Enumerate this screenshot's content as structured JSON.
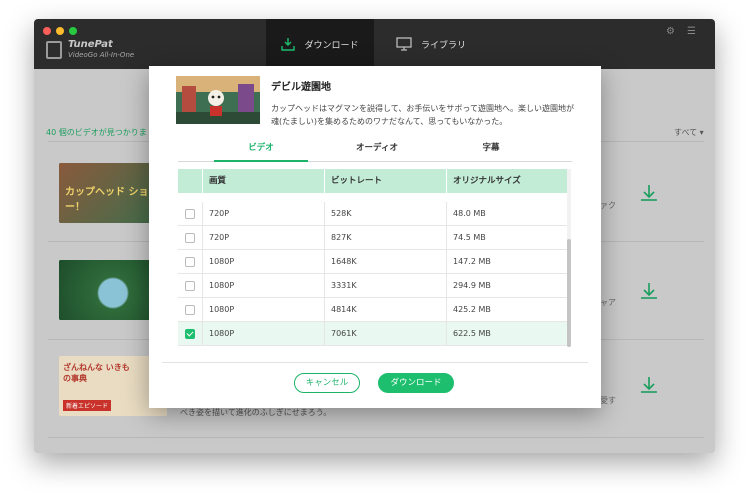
{
  "app": {
    "name": "TunePat",
    "subtitle": "VideoGo All-In-One",
    "tabs": [
      {
        "label": "ダウンロード",
        "active": true
      },
      {
        "label": "ライブラリ",
        "active": false
      }
    ],
    "accent": "#1dbf6e"
  },
  "background": {
    "found_text": "40 個のビデオが見つかりま",
    "filter": "すべて",
    "rows": [
      {
        "thumb_text": "カップヘッド ショー！",
        "right_text": "ァク"
      },
      {
        "thumb_text": "",
        "right_text": "ャア"
      },
      {
        "thumb_text": "ざんねんな いきもの事典",
        "badge": "新着エピソード",
        "right_text": "愛す",
        "desc": "べき姿を描いて進化のふしぎにせまろう。"
      }
    ]
  },
  "dialog": {
    "title": "デビル遊園地",
    "description": "カップヘッドはマグマンを説得して、お手伝いをサボって遊園地へ。楽しい遊園地が魂(たましい)を集めるためのワナだなんて、思ってもいなかった。",
    "tabs": [
      {
        "label": "ビデオ",
        "active": true
      },
      {
        "label": "オーディオ",
        "active": false
      },
      {
        "label": "字幕",
        "active": false
      }
    ],
    "table": {
      "headers": [
        "画質",
        "ビットレート",
        "オリジナルサイズ"
      ],
      "rows": [
        {
          "quality": "720P",
          "bitrate": "528K",
          "size": "48.0 MB",
          "checked": false
        },
        {
          "quality": "720P",
          "bitrate": "827K",
          "size": "74.5 MB",
          "checked": false
        },
        {
          "quality": "1080P",
          "bitrate": "1648K",
          "size": "147.2 MB",
          "checked": false
        },
        {
          "quality": "1080P",
          "bitrate": "3331K",
          "size": "294.9 MB",
          "checked": false
        },
        {
          "quality": "1080P",
          "bitrate": "4814K",
          "size": "425.2 MB",
          "checked": false
        },
        {
          "quality": "1080P",
          "bitrate": "7061K",
          "size": "622.5 MB",
          "checked": true
        }
      ]
    },
    "cancel_label": "キャンセル",
    "download_label": "ダウンロード"
  }
}
